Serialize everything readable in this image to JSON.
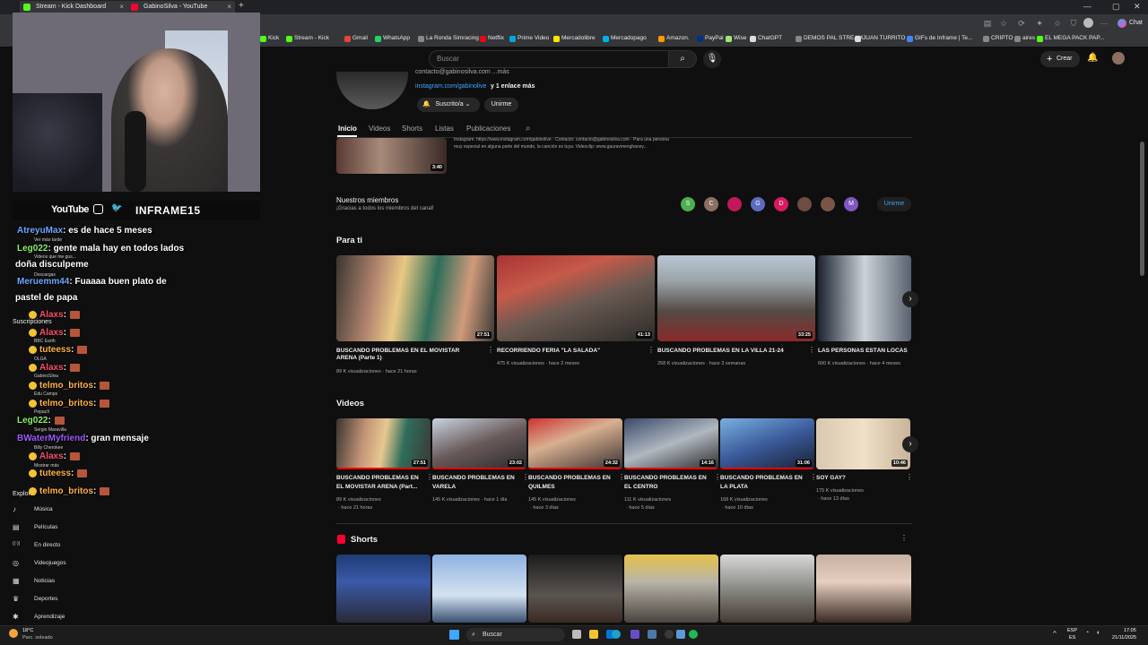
{
  "browser": {
    "tabs": [
      {
        "title": "Stream - Kick Dashboard",
        "color": "#53fc18"
      },
      {
        "title": "GabinoSilva - YouTube",
        "color": "#ff0033"
      }
    ],
    "new_tab": "+",
    "bookmarks": [
      {
        "label": "Kick",
        "color": "#53fc18"
      },
      {
        "label": "Stream - Kick",
        "color": "#53fc18"
      },
      {
        "label": "Gmail",
        "color": "#ea4335"
      },
      {
        "label": "WhatsApp",
        "color": "#25d366"
      },
      {
        "label": "La Ronda Simracing",
        "color": "#888888"
      },
      {
        "label": "Netflix",
        "color": "#e50914"
      },
      {
        "label": "Prime Video",
        "color": "#00a8e1"
      },
      {
        "label": "Mercadolibre",
        "color": "#ffe600"
      },
      {
        "label": "Mercadopago",
        "color": "#00b1ea"
      },
      {
        "label": "Amazon.",
        "color": "#ff9900"
      },
      {
        "label": "PayPal",
        "color": "#003087"
      },
      {
        "label": "Wise",
        "color": "#9fe870"
      },
      {
        "label": "ChatGPT",
        "color": "#dddddd"
      },
      {
        "label": "DEMOS PAL STREAM",
        "color": "#888888"
      },
      {
        "label": "JUAN TURRITO",
        "color": "#dddddd"
      },
      {
        "label": "GIFs de Inframe | Te...",
        "color": "#4285f4"
      },
      {
        "label": "CRIPTO",
        "color": "#888888"
      },
      {
        "label": "aires",
        "color": "#888888"
      },
      {
        "label": "EL MEGA PACK PAP...",
        "color": "#53fc18"
      }
    ],
    "chat_label": "Chat"
  },
  "youtube": {
    "search_placeholder": "Buscar",
    "create_label": "Crear",
    "channel": {
      "contact": "contacto@gabinosilva.com ...más",
      "link": "instagram.com/gabinolive",
      "link_more": "y 1 enlace más",
      "subscribed_label": "Suscrito/a",
      "join_label": "Unirme"
    },
    "tabs": [
      "Inicio",
      "Videos",
      "Shorts",
      "Listas",
      "Publicaciones"
    ],
    "featured": {
      "desc_line1": "Instagram: https://www.instagram.com/gabinolive · Contacto: contacto@gabinosilva.com · Para una persona",
      "desc_line2": "muy especial en alguna parte del mundo, la canción es tuya. Videoclip: www.gauravmenghaney...",
      "duration": "3:40"
    },
    "members": {
      "title": "Nuestros miembros",
      "subtitle": "¡Gracias a todos los miembros del canal!",
      "avatars": [
        {
          "letter": "S",
          "color": "#4caf50"
        },
        {
          "letter": "C",
          "color": "#8d6e63"
        },
        {
          "letter": "",
          "color": "#c2185b"
        },
        {
          "letter": "G",
          "color": "#5c6bc0"
        },
        {
          "letter": "D",
          "color": "#d81b60"
        },
        {
          "letter": "",
          "color": "#6d4c41"
        },
        {
          "letter": "",
          "color": "#795548"
        },
        {
          "letter": "M",
          "color": "#7e57c2"
        }
      ],
      "join_label": "Unirme"
    },
    "para_ti": {
      "title": "Para ti",
      "videos": [
        {
          "title": "BUSCANDO PROBLEMAS EN EL MOVISTAR ARENA (Parte 1)",
          "meta": "89 K visualizaciones · hace 21 horas",
          "duration": "27:51"
        },
        {
          "title": "RECORRIENDO FERIA \"LA SALADA\"",
          "meta": "475 K visualizaciones · hace 2 meses",
          "duration": "41:13"
        },
        {
          "title": "BUSCANDO PROBLEMAS EN LA VILLA 21-24",
          "meta": "258 K visualizaciones · hace 3 semanas",
          "duration": "33:25"
        },
        {
          "title": "LAS PERSONAS ESTÁN LOCAS",
          "meta": "600 K visualizaciones · hace 4 meses",
          "duration": ""
        }
      ]
    },
    "videos": {
      "title": "Videos",
      "items": [
        {
          "title1": "BUSCANDO PROBLEMAS EN",
          "title2": "EL MOVISTAR ARENA (Part...",
          "meta1": "89 K visualizaciones",
          "meta2": "· hace 21 horas",
          "duration": "27:51"
        },
        {
          "title1": "BUSCANDO PROBLEMAS EN",
          "title2": "VARELA",
          "meta1": "145 K visualizaciones · hace 1 día",
          "meta2": "",
          "duration": "23:02"
        },
        {
          "title1": "BUSCANDO PROBLEMAS EN",
          "title2": "QUILMES",
          "meta1": "145 K visualizaciones",
          "meta2": "· hace 3 días",
          "duration": "24:32"
        },
        {
          "title1": "BUSCANDO PROBLEMAS EN",
          "title2": "EL CENTRO",
          "meta1": "111 K visualizaciones",
          "meta2": "· hace 5 días",
          "duration": "14:16"
        },
        {
          "title1": "BUSCANDO PROBLEMAS EN",
          "title2": "LA PLATA",
          "meta1": "168 K visualizaciones",
          "meta2": "· hace 10 días",
          "duration": "31:06"
        },
        {
          "title1": "SOY GAY?",
          "title2": "",
          "meta1": "175 K visualizaciones",
          "meta2": "· hace 13 días",
          "duration": "10:46"
        }
      ]
    },
    "shorts": {
      "title": "Shorts"
    }
  },
  "overlay": {
    "social_youtube": "YouTube",
    "handle": "INFRAME15",
    "chat": [
      {
        "user": "AtreyuMax",
        "msg": ": es de hace 5 meses",
        "color": "#6aa9ff"
      },
      {
        "user": "Leg022",
        "msg": ": gente mala hay en todos lados",
        "color": "#8bf26a"
      },
      {
        "user": "",
        "msg": "doña disculpeme",
        "color": "#ffffff"
      },
      {
        "user": "Meruemm44",
        "msg": ": Fuaaaa buen plato de",
        "color": "#6aa9ff"
      },
      {
        "user": "",
        "msg": "pastel de papa",
        "color": "#ffffff"
      },
      {
        "user": "Alaxs",
        "msg": ":",
        "color": "#ff4d6d"
      },
      {
        "user": "Alaxs",
        "msg": ":",
        "color": "#ff4d6d"
      },
      {
        "user": "tuteess",
        "msg": ":",
        "color": "#ffb347"
      },
      {
        "user": "Alaxs",
        "msg": ":",
        "color": "#ff4d6d"
      },
      {
        "user": "telmo_britos",
        "msg": ":",
        "color": "#ffb347"
      },
      {
        "user": "telmo_britos",
        "msg": ":",
        "color": "#ffb347"
      },
      {
        "user": "Leg022",
        "msg": ":",
        "color": "#8bf26a"
      },
      {
        "user": "BWaterMyfriend",
        "msg": ": gran mensaje",
        "color": "#9b59ff"
      },
      {
        "user": "Alaxs",
        "msg": ":",
        "color": "#ff4d6d"
      },
      {
        "user": "tuteess",
        "msg": ":",
        "color": "#ffb347"
      },
      {
        "user": "telmo_britos",
        "msg": ":",
        "color": "#ffb347"
      }
    ],
    "sidebar_ghost": [
      "Ver más tarde",
      "Videos que me gus...",
      "Descargas",
      "Suscripciones",
      "BBC Earth",
      "OLGA",
      "GabinoSilva",
      "Edu Camps",
      "PepazX",
      "Sergio Maravilla",
      "Billy Cherokee",
      "Mostrar más",
      "Explorar"
    ]
  },
  "sidebar": {
    "items": [
      {
        "label": "Música",
        "icon": "music-icon"
      },
      {
        "label": "Películas",
        "icon": "film-icon"
      },
      {
        "label": "En directo",
        "icon": "live-icon"
      },
      {
        "label": "Videojuegos",
        "icon": "gamepad-icon"
      },
      {
        "label": "Noticias",
        "icon": "news-icon"
      },
      {
        "label": "Deportes",
        "icon": "trophy-icon"
      },
      {
        "label": "Aprendizaje",
        "icon": "bulb-icon"
      }
    ]
  },
  "taskbar": {
    "weather_temp": "18°C",
    "weather_text": "Parc. soleado",
    "search": "Buscar",
    "lang1": "ESP",
    "lang2": "ES",
    "time": "17:05",
    "date": "21/11/2025"
  }
}
